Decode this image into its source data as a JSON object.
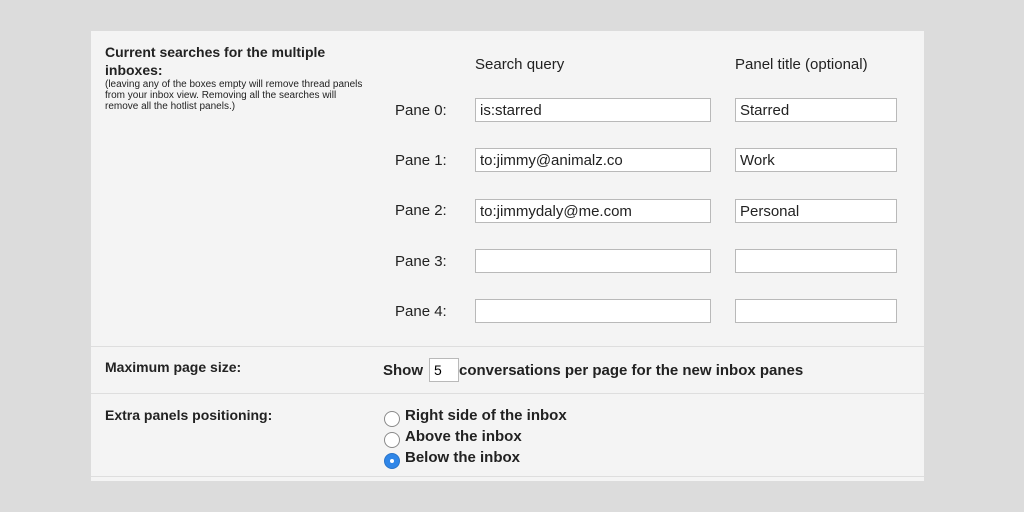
{
  "multiple_inboxes": {
    "section_title_line1": "Current searches for the multiple",
    "section_title_line2": "inboxes:",
    "note": "(leaving any of the boxes empty will remove thread panels from your inbox view. Removing all the searches will remove all the hotlist panels.)",
    "col_query": "Search query",
    "col_title": "Panel title (optional)",
    "panes": [
      {
        "label": "Pane 0:",
        "query": "is:starred",
        "title": "Starred"
      },
      {
        "label": "Pane 1:",
        "query": "to:jimmy@animalz.co",
        "title": "Work"
      },
      {
        "label": "Pane 2:",
        "query": "to:jimmydaly@me.com",
        "title": "Personal"
      },
      {
        "label": "Pane 3:",
        "query": "",
        "title": ""
      },
      {
        "label": "Pane 4:",
        "query": "",
        "title": ""
      }
    ]
  },
  "page_size": {
    "label": "Maximum page size:",
    "show_text": "Show",
    "value": "5",
    "suffix": "conversations per page for the new inbox panes"
  },
  "positioning": {
    "label": "Extra panels positioning:",
    "options": [
      {
        "label": "Right side of the inbox",
        "checked": false
      },
      {
        "label": "Above the inbox",
        "checked": false
      },
      {
        "label": "Below the inbox",
        "checked": true
      }
    ]
  },
  "colors": {
    "accent": "#2f86e8",
    "panel_bg": "#f4f4f4",
    "page_bg": "#dcdcdc"
  }
}
